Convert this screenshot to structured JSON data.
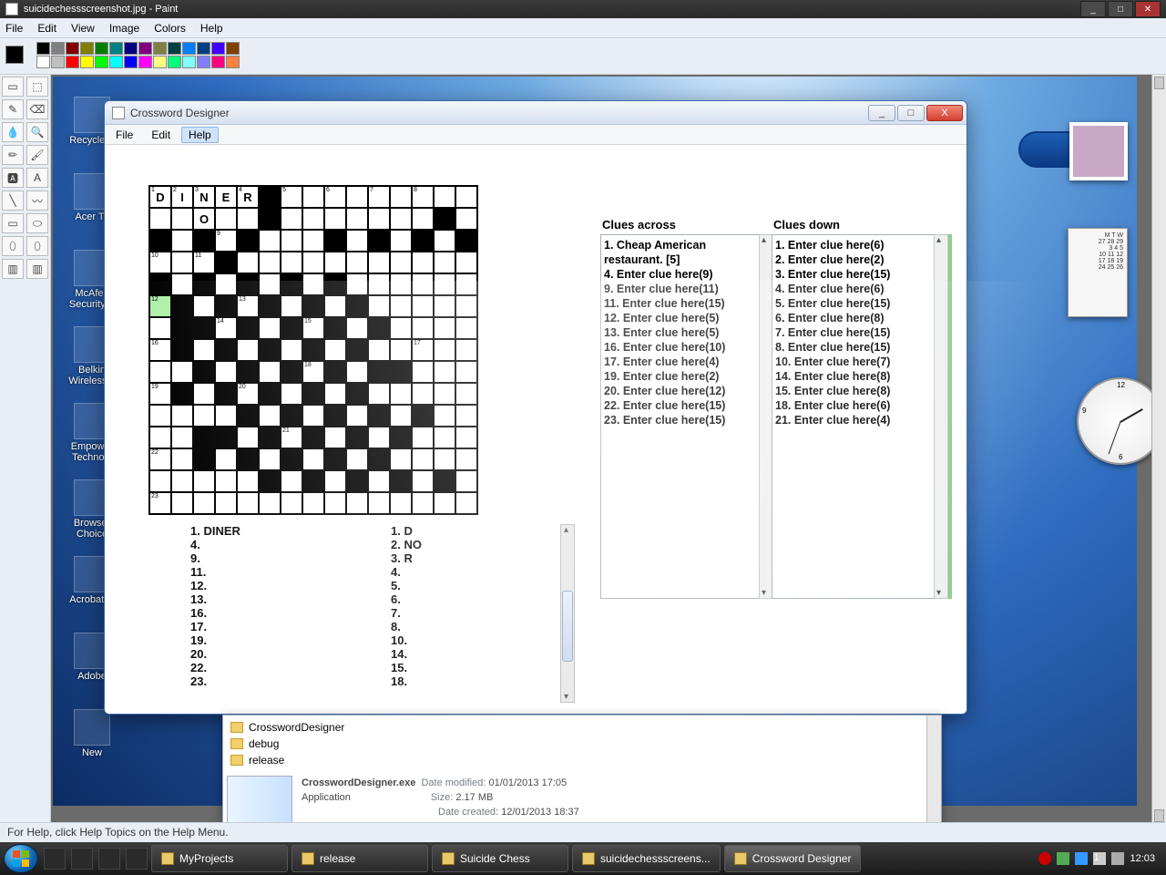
{
  "paint": {
    "title": "suicidechessscreenshot.jpg - Paint",
    "menu": [
      "File",
      "Edit",
      "View",
      "Image",
      "Colors",
      "Help"
    ],
    "status": "For Help, click Help Topics on the Help Menu.",
    "palette": [
      "#000000",
      "#808080",
      "#800000",
      "#808000",
      "#008000",
      "#008080",
      "#000080",
      "#800080",
      "#808040",
      "#004040",
      "#0080ff",
      "#004080",
      "#4000ff",
      "#804000",
      "#ffffff",
      "#c0c0c0",
      "#ff0000",
      "#ffff00",
      "#00ff00",
      "#00ffff",
      "#0000ff",
      "#ff00ff",
      "#ffff80",
      "#00ff80",
      "#80ffff",
      "#8080ff",
      "#ff0080",
      "#ff8040"
    ]
  },
  "desktop_icons": [
    "Recycle B",
    "Acer To",
    "McAfee Security S",
    "Belkin Wireless L",
    "Empower Technolo",
    "Browser Choice",
    "Acrobat_c",
    "Adobe",
    "New"
  ],
  "calendar": {
    "dow": "M  T  W",
    "rows": [
      "27 28 29",
      "3  4  5",
      "10 11 12",
      "17 18 19",
      "24 25 26"
    ]
  },
  "folder": {
    "items": [
      "CrosswordDesigner",
      "debug",
      "release"
    ],
    "file": "CrosswordDesigner.exe",
    "kind": "Application",
    "modified_label": "Date modified:",
    "modified": "01/01/2013 17:05",
    "size_label": "Size:",
    "size": "2.17 MB",
    "created_label": "Date created:",
    "created": "12/01/2013 18:37"
  },
  "cd": {
    "title": "Crossword Designer",
    "menu": [
      "File",
      "Edit",
      "Help"
    ],
    "active_menu": 2,
    "across_header": "Clues across",
    "down_header": "Clues down",
    "clues_across": [
      "1. Cheap American restaurant. [5]",
      "4. Enter clue here(9)",
      "9. Enter clue here(11)",
      "11. Enter clue here(15)",
      "12. Enter clue here(5)",
      "13. Enter clue here(5)",
      "16. Enter clue here(10)",
      "17. Enter clue here(4)",
      "19. Enter clue here(2)",
      "20. Enter clue here(12)",
      "22. Enter clue here(15)",
      "23. Enter clue here(15)"
    ],
    "clues_down": [
      "1. Enter clue here(6)",
      "2. Enter clue here(2)",
      "3. Enter clue here(15)",
      "4. Enter clue here(6)",
      "5. Enter clue here(15)",
      "6. Enter clue here(8)",
      "7. Enter clue here(15)",
      "8. Enter clue here(15)",
      "10. Enter clue here(7)",
      "14. Enter clue here(8)",
      "15. Enter clue here(8)",
      "18. Enter clue here(6)",
      "21. Enter clue here(4)"
    ],
    "answers_across": [
      "1. DINER",
      "4.",
      "9.",
      "11.",
      "12.",
      "13.",
      "16.",
      "17.",
      "19.",
      "20.",
      "22.",
      "23."
    ],
    "answers_down": [
      "1. D",
      "2. NO",
      "3. R",
      "4.",
      "5.",
      "6.",
      "7.",
      "8.",
      "10.",
      "14.",
      "15.",
      "18."
    ],
    "grid": {
      "black": [
        5,
        20,
        28,
        30,
        32,
        34,
        38,
        40,
        42,
        44,
        48,
        60,
        62,
        64,
        66,
        68,
        76,
        78,
        80,
        82,
        84,
        91,
        92,
        94,
        96,
        98,
        100,
        106,
        108,
        110,
        112,
        114,
        122,
        124,
        126,
        128,
        130,
        131,
        136,
        138,
        140,
        142,
        144,
        154,
        156,
        158,
        160,
        162,
        167,
        168,
        170,
        172,
        174,
        176,
        182,
        184,
        186,
        188,
        190,
        200,
        202,
        204,
        206,
        208
      ],
      "numbers": {
        "0": "1",
        "1": "2",
        "2": "3",
        "4": "4",
        "6": "5",
        "8": "6",
        "10": "7",
        "12": "8",
        "33": "9",
        "45": "10",
        "47": "11",
        "75": "12",
        "79": "13",
        "93": "14",
        "97": "15",
        "105": "16",
        "117": "17",
        "127": "18",
        "135": "19",
        "139": "20",
        "171": "21",
        "180": "22",
        "210": "23"
      },
      "letters": {
        "0": "D",
        "1": "I",
        "2": "N",
        "3": "E",
        "4": "R",
        "17": "O"
      },
      "highlight": 75
    }
  },
  "taskbar": {
    "tasks": [
      "MyProjects",
      "release",
      "Suicide Chess",
      "suicidechessscreens...",
      "Crossword Designer"
    ],
    "active": 4,
    "clock": "12:03"
  }
}
